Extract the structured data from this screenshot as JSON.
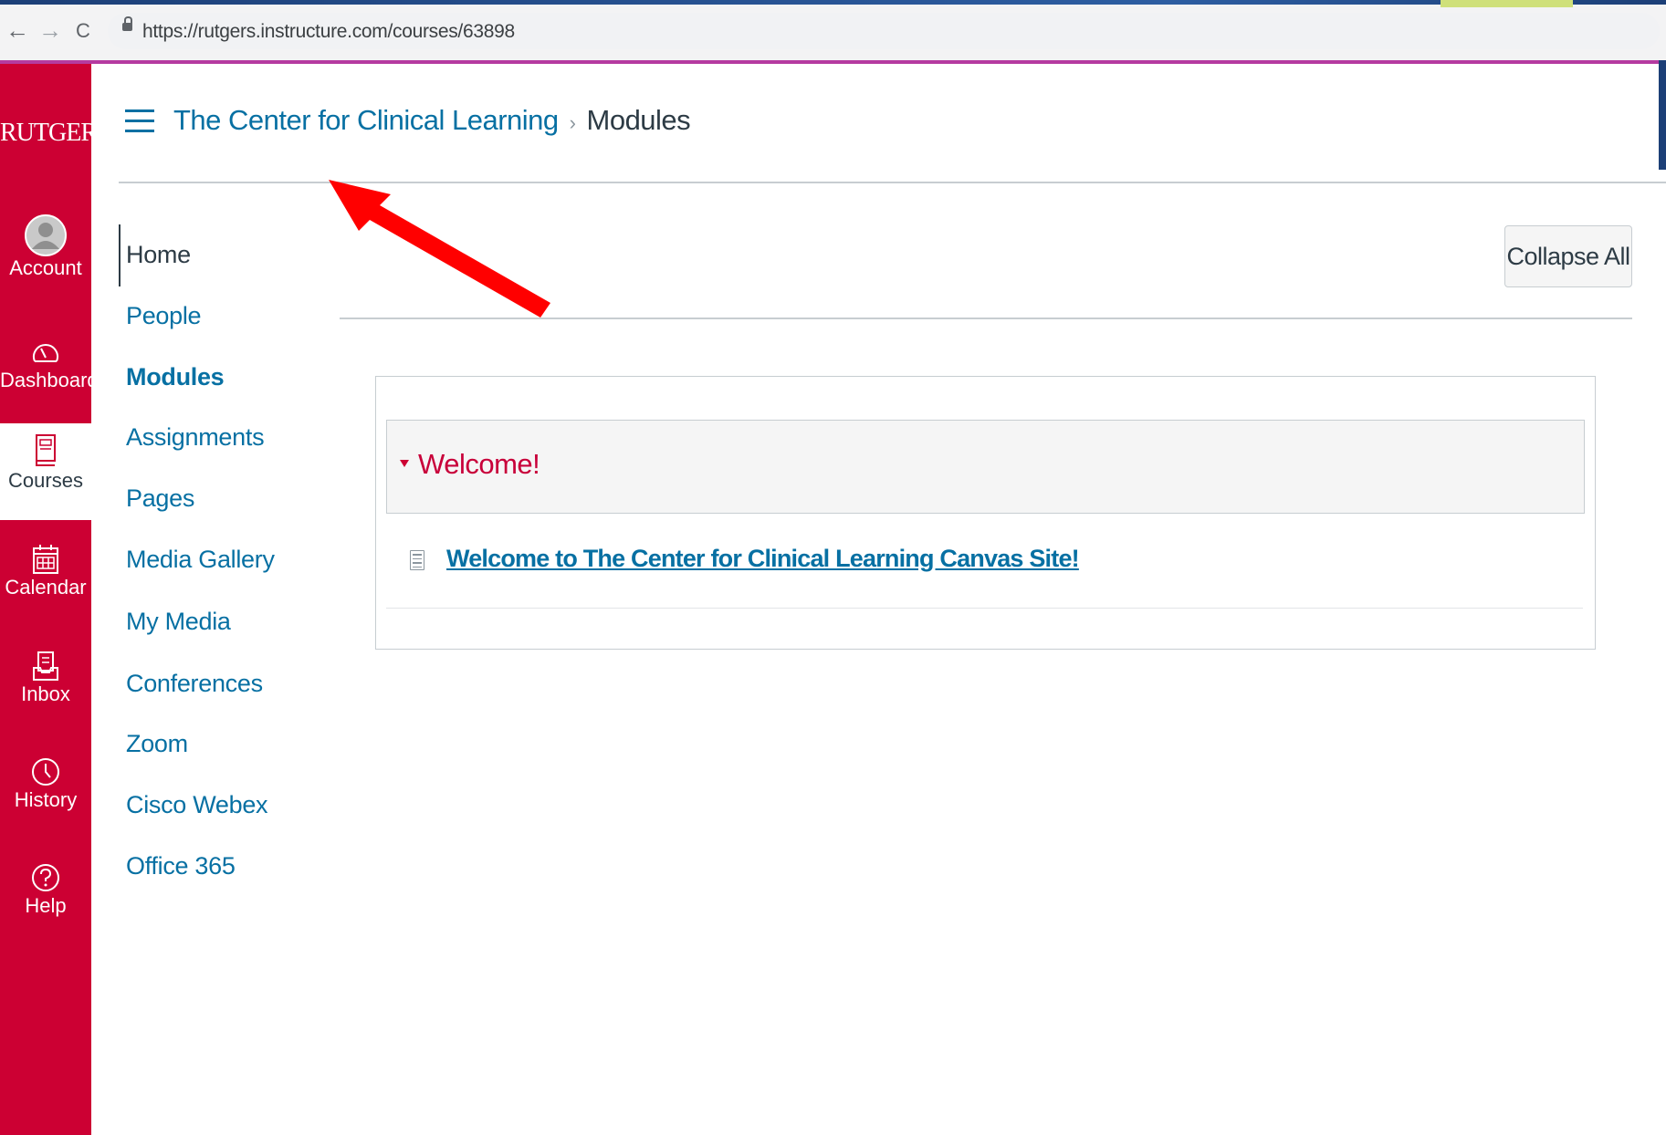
{
  "browser": {
    "back_icon": "←",
    "forward_icon": "→",
    "reload_icon": "C",
    "url": "https://rutgers.instructure.com/courses/63898"
  },
  "global_nav": {
    "logo": "RUTGERS",
    "items": [
      {
        "label": "Account",
        "icon": "avatar-icon"
      },
      {
        "label": "Dashboard",
        "icon": "dashboard-icon"
      },
      {
        "label": "Courses",
        "icon": "courses-icon"
      },
      {
        "label": "Calendar",
        "icon": "calendar-icon"
      },
      {
        "label": "Inbox",
        "icon": "inbox-icon"
      },
      {
        "label": "History",
        "icon": "history-icon"
      },
      {
        "label": "Help",
        "icon": "help-icon"
      }
    ]
  },
  "breadcrumb": {
    "course": "The Center for Clinical Learning",
    "separator": "›",
    "current": "Modules"
  },
  "course_nav": {
    "items": [
      "Home",
      "People",
      "Modules",
      "Assignments",
      "Pages",
      "Media Gallery",
      "My Media",
      "Conferences",
      "Zoom",
      "Cisco Webex",
      "Office 365"
    ]
  },
  "toolbar": {
    "collapse_all": "Collapse All"
  },
  "module": {
    "title": "Welcome!",
    "items": [
      {
        "label": "Welcome to The Center for Clinical Learning Canvas Site!",
        "icon": "document-icon"
      }
    ]
  },
  "colors": {
    "brand_red": "#cc0033",
    "link_blue": "#0770a3",
    "annotation_arrow": "#ff0000"
  }
}
